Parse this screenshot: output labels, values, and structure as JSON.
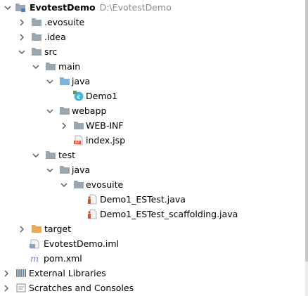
{
  "project": {
    "name": "EvotestDemo",
    "path": "D:\\EvotestDemo"
  },
  "tree": {
    "evosuite_dir": ".evosuite",
    "idea_dir": ".idea",
    "src_dir": "src",
    "main_dir": "main",
    "java_dir_main": "java",
    "demo_class": "Demo1",
    "webapp_dir": "webapp",
    "webinf_dir": "WEB-INF",
    "index_file": "index.jsp",
    "test_dir": "test",
    "java_dir_test": "java",
    "evosuite_pkg": "evosuite",
    "estest_file": "Demo1_ESTest.java",
    "scaffolding_file": "Demo1_ESTest_scaffolding.java",
    "target_dir": "target",
    "iml_file": "EvotestDemo.iml",
    "pom_file": "pom.xml",
    "external_libraries": "External Libraries",
    "scratches": "Scratches and Consoles"
  },
  "colors": {
    "folder": "#9aa7b0",
    "source_folder": "#7fb3d8",
    "test_folder": "#8fbf7f",
    "excluded_folder": "#e8a85a",
    "class_icon": "#40b6e0",
    "maven_m": "#6a8fc4"
  }
}
